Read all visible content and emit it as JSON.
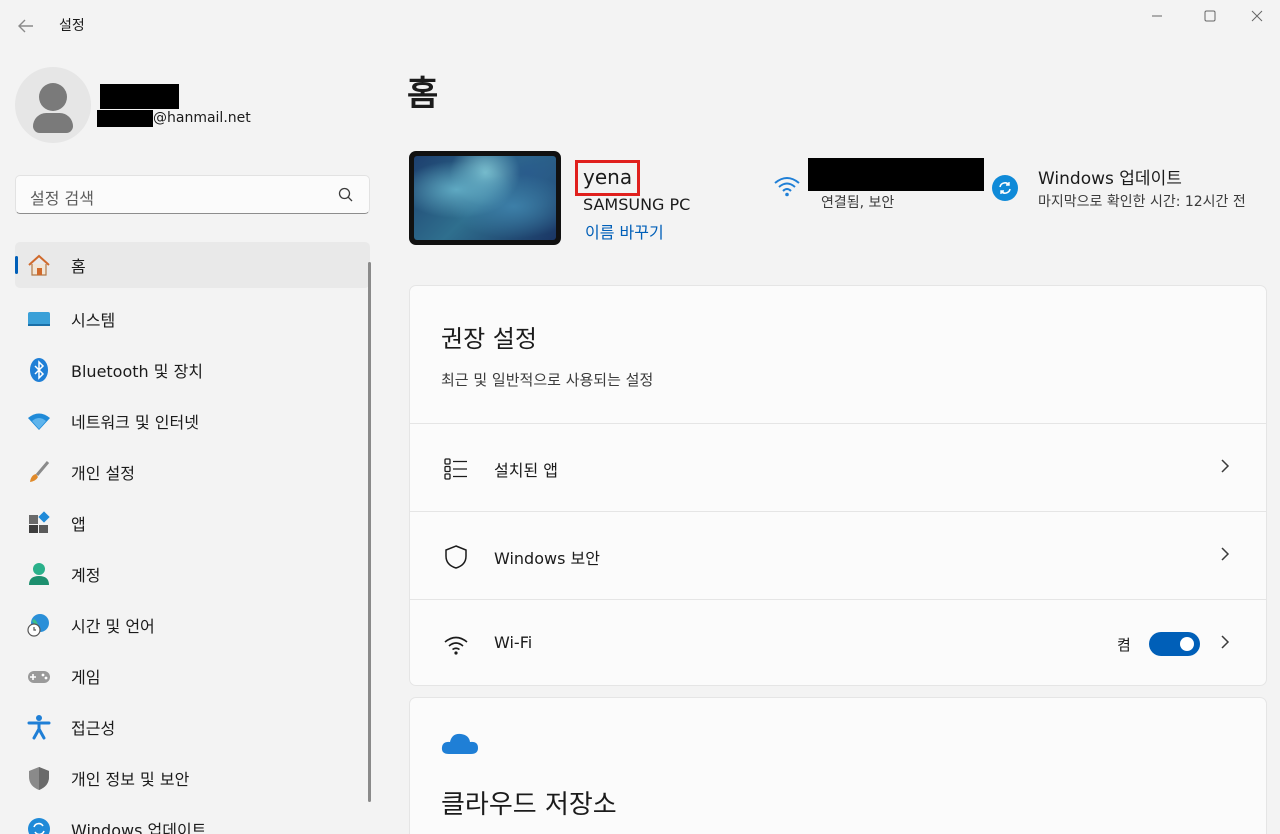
{
  "window": {
    "title": "설정",
    "back_icon": "back-arrow-icon",
    "minimize": "—",
    "maximize": "☐",
    "close": "✕"
  },
  "profile": {
    "email": "@hanmail.net"
  },
  "search": {
    "placeholder": "설정 검색"
  },
  "sidebar": {
    "items": [
      {
        "label": "홈",
        "icon": "home-icon",
        "active": true
      },
      {
        "label": "시스템",
        "icon": "system-icon"
      },
      {
        "label": "Bluetooth 및 장치",
        "icon": "bluetooth-icon"
      },
      {
        "label": "네트워크 및 인터넷",
        "icon": "network-icon"
      },
      {
        "label": "개인 설정",
        "icon": "brush-icon"
      },
      {
        "label": "앱",
        "icon": "apps-icon"
      },
      {
        "label": "계정",
        "icon": "account-icon"
      },
      {
        "label": "시간 및 언어",
        "icon": "time-language-icon"
      },
      {
        "label": "게임",
        "icon": "gaming-icon"
      },
      {
        "label": "접근성",
        "icon": "accessibility-icon"
      },
      {
        "label": "개인 정보 및 보안",
        "icon": "shield-icon"
      },
      {
        "label": "Windows 업데이트",
        "icon": "update-icon"
      }
    ]
  },
  "main": {
    "title": "홈",
    "device": {
      "name": "yena",
      "model": "SAMSUNG PC",
      "rename": "이름 바꾸기"
    },
    "network": {
      "status": "연결됨, 보안"
    },
    "update": {
      "title": "Windows 업데이트",
      "subtitle": "마지막으로 확인한 시간: 12시간 전"
    },
    "recommended": {
      "title": "권장 설정",
      "subtitle": "최근 및 일반적으로 사용되는 설정",
      "rows": [
        {
          "label": "설치된 앱",
          "icon": "installed-apps-icon"
        },
        {
          "label": "Windows 보안",
          "icon": "security-shield-icon"
        },
        {
          "label": "Wi-Fi",
          "icon": "wifi-icon",
          "toggle_state": "켬",
          "toggle_on": true
        }
      ]
    },
    "cloud": {
      "title": "클라우드 저장소"
    }
  },
  "colors": {
    "accent": "#005fb8",
    "highlight_box": "#e0201d"
  }
}
